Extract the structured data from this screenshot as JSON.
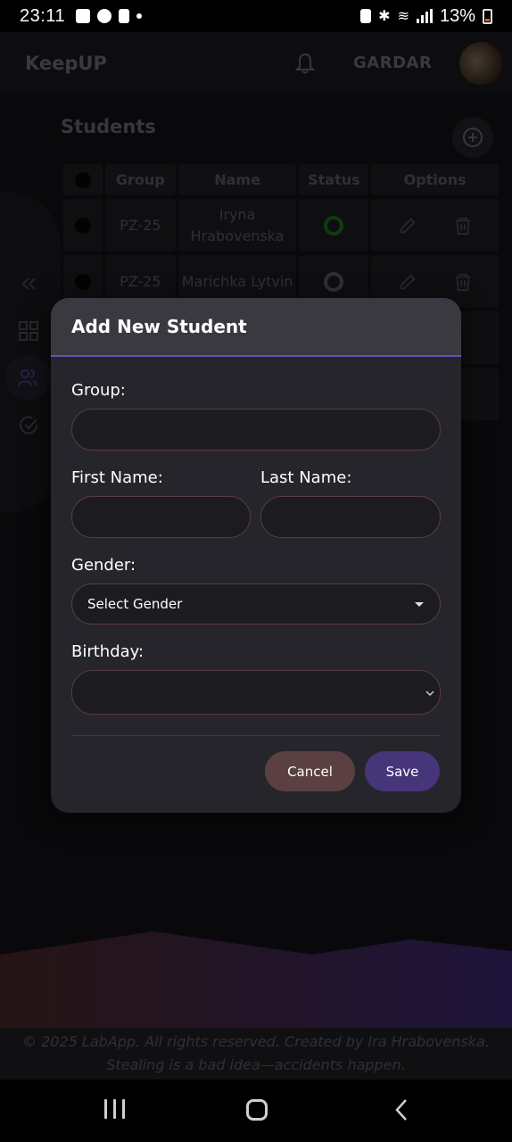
{
  "status_bar": {
    "time": "23:11",
    "battery": "13%"
  },
  "app": {
    "brand": "KeepUP",
    "user": "GARDAR"
  },
  "page": {
    "title": "Students"
  },
  "table": {
    "headers": [
      "",
      "Group",
      "Name",
      "Status",
      "Options"
    ],
    "rows": [
      {
        "group": "PZ-25",
        "name": "Iryna Hrabovenska",
        "status": "active"
      },
      {
        "group": "PZ-25",
        "name": "Marichka Lytvin",
        "status": "inactive"
      }
    ]
  },
  "modal": {
    "title": "Add New Student",
    "group_label": "Group:",
    "first_name_label": "First Name:",
    "last_name_label": "Last Name:",
    "gender_label": "Gender:",
    "gender_value": "Select Gender",
    "birthday_label": "Birthday:",
    "cancel_label": "Cancel",
    "save_label": "Save"
  },
  "footer": {
    "line1": "© 2025 LabApp. All rights reserved. Created by Ira Hrabovenska.",
    "line2": "Stealing is a bad idea—accidents happen."
  },
  "colors": {
    "accent": "#6b4fb8",
    "save": "#463579",
    "cancel": "#5b4042",
    "status_active": "#1a5a1a"
  }
}
